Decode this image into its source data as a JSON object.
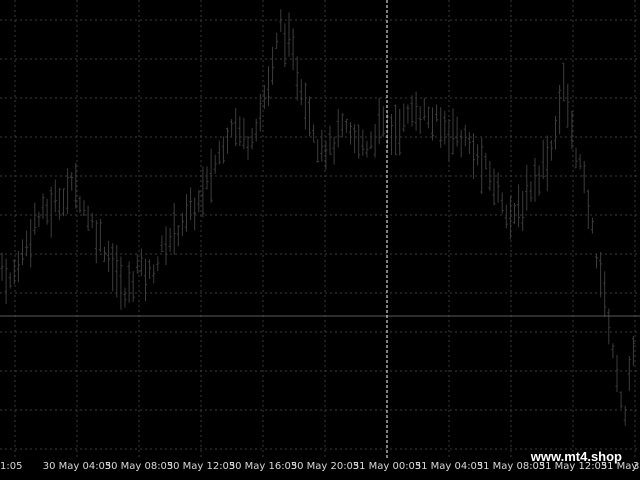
{
  "chart_window": {
    "background": "#000000",
    "grid_color": "#3a3a3a",
    "bar_color": "#3c3c3c",
    "separator_color": "#ffffff",
    "bid_line_color": "#5a5a5a",
    "grid": true,
    "separator_label": "31 May 00:05",
    "watermark": "www.mt4.shop"
  },
  "chart_data": {
    "type": "bar",
    "title": "",
    "xlabel": "",
    "ylabel": "",
    "ylim": [
      0,
      100
    ],
    "x_ticks": [
      "1:05",
      "30 May 04:05",
      "30 May 08:05",
      "30 May 12:05",
      "30 May 16:05",
      "30 May 20:05",
      "31 May 00:05",
      "31 May 04:05",
      "31 May 08:05",
      "31 May 12:05",
      "31 May 16:05",
      "3"
    ],
    "price_anchors": [
      [
        0,
        42
      ],
      [
        2,
        38
      ],
      [
        5,
        45
      ],
      [
        8,
        52
      ],
      [
        12,
        55
      ],
      [
        15,
        58
      ],
      [
        18,
        60
      ],
      [
        20,
        55
      ],
      [
        24,
        48
      ],
      [
        27,
        43
      ],
      [
        30,
        35
      ],
      [
        33,
        42
      ],
      [
        36,
        40
      ],
      [
        40,
        47
      ],
      [
        44,
        52
      ],
      [
        48,
        56
      ],
      [
        50,
        60
      ],
      [
        53,
        67
      ],
      [
        56,
        74
      ],
      [
        60,
        70
      ],
      [
        63,
        76
      ],
      [
        66,
        86
      ],
      [
        68,
        96
      ],
      [
        71,
        88
      ],
      [
        74,
        79
      ],
      [
        77,
        70
      ],
      [
        80,
        68
      ],
      [
        83,
        72
      ],
      [
        86,
        70
      ],
      [
        89,
        69
      ],
      [
        92,
        73
      ],
      [
        95,
        72
      ],
      [
        98,
        74
      ],
      [
        101,
        77
      ],
      [
        104,
        75
      ],
      [
        107,
        73
      ],
      [
        110,
        72
      ],
      [
        113,
        70
      ],
      [
        116,
        66
      ],
      [
        119,
        62
      ],
      [
        122,
        57
      ],
      [
        125,
        52
      ],
      [
        128,
        58
      ],
      [
        131,
        63
      ],
      [
        134,
        68
      ],
      [
        137,
        82
      ],
      [
        139,
        72
      ],
      [
        142,
        60
      ],
      [
        145,
        45
      ],
      [
        148,
        30
      ],
      [
        150,
        17
      ],
      [
        152,
        10
      ],
      [
        154,
        22
      ]
    ]
  }
}
